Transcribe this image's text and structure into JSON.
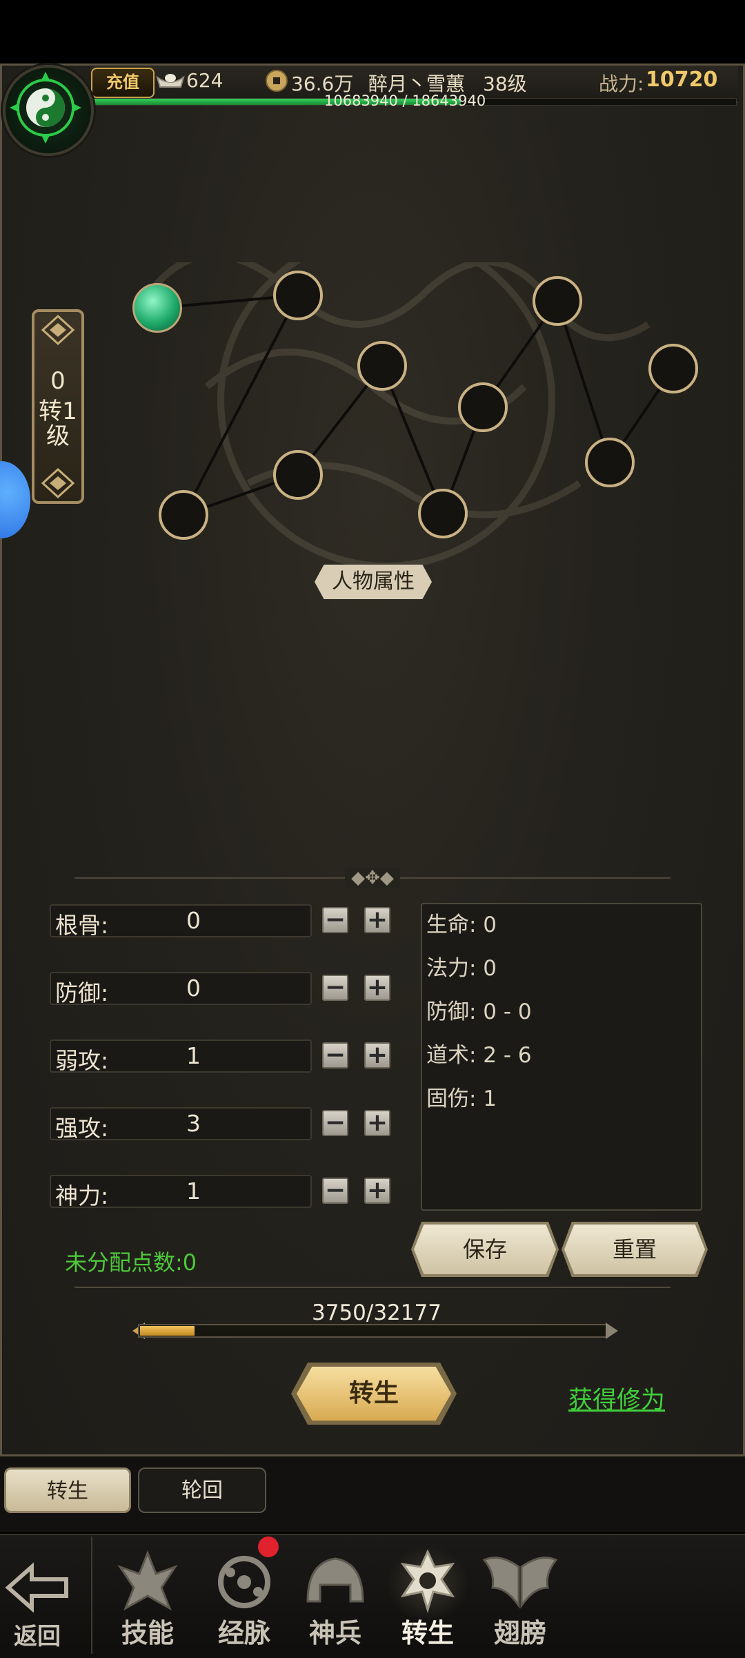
{
  "topbar": {
    "recharge_label": "充值",
    "ingots": "624",
    "coins": "36.6万",
    "player_name": "醉月丶雪蕙",
    "level": "38级",
    "power_label": "战力:",
    "power_value": "10720",
    "exp_text": "10683940 / 18643940",
    "exp_fraction": 0.573
  },
  "rebirth_level": {
    "line1": "0",
    "line2": "转1",
    "line3": "级"
  },
  "attr_tag": "人物属性",
  "stats": [
    {
      "label": "根骨:",
      "value": "0"
    },
    {
      "label": "防御:",
      "value": "0"
    },
    {
      "label": "弱攻:",
      "value": "1"
    },
    {
      "label": "强攻:",
      "value": "3"
    },
    {
      "label": "神力:",
      "value": "1"
    }
  ],
  "derived": [
    "生命: 0",
    "法力: 0",
    "防御: 0 - 0",
    "道术: 2 - 6",
    "固伤: 1"
  ],
  "buttons": {
    "save": "保存",
    "reset": "重置",
    "rebirth": "转生",
    "gain": "获得修为"
  },
  "unallocated": "未分配点数:0",
  "progress": {
    "text": "3750/32177",
    "fraction": 0.1165
  },
  "subtabs": [
    "转生",
    "轮回"
  ],
  "nav": {
    "back": "返回",
    "items": [
      "技能",
      "经脉",
      "神兵",
      "转生",
      "翅膀"
    ]
  },
  "colors": {
    "accent_green": "#4ec93a",
    "gold": "#d8aa52"
  }
}
